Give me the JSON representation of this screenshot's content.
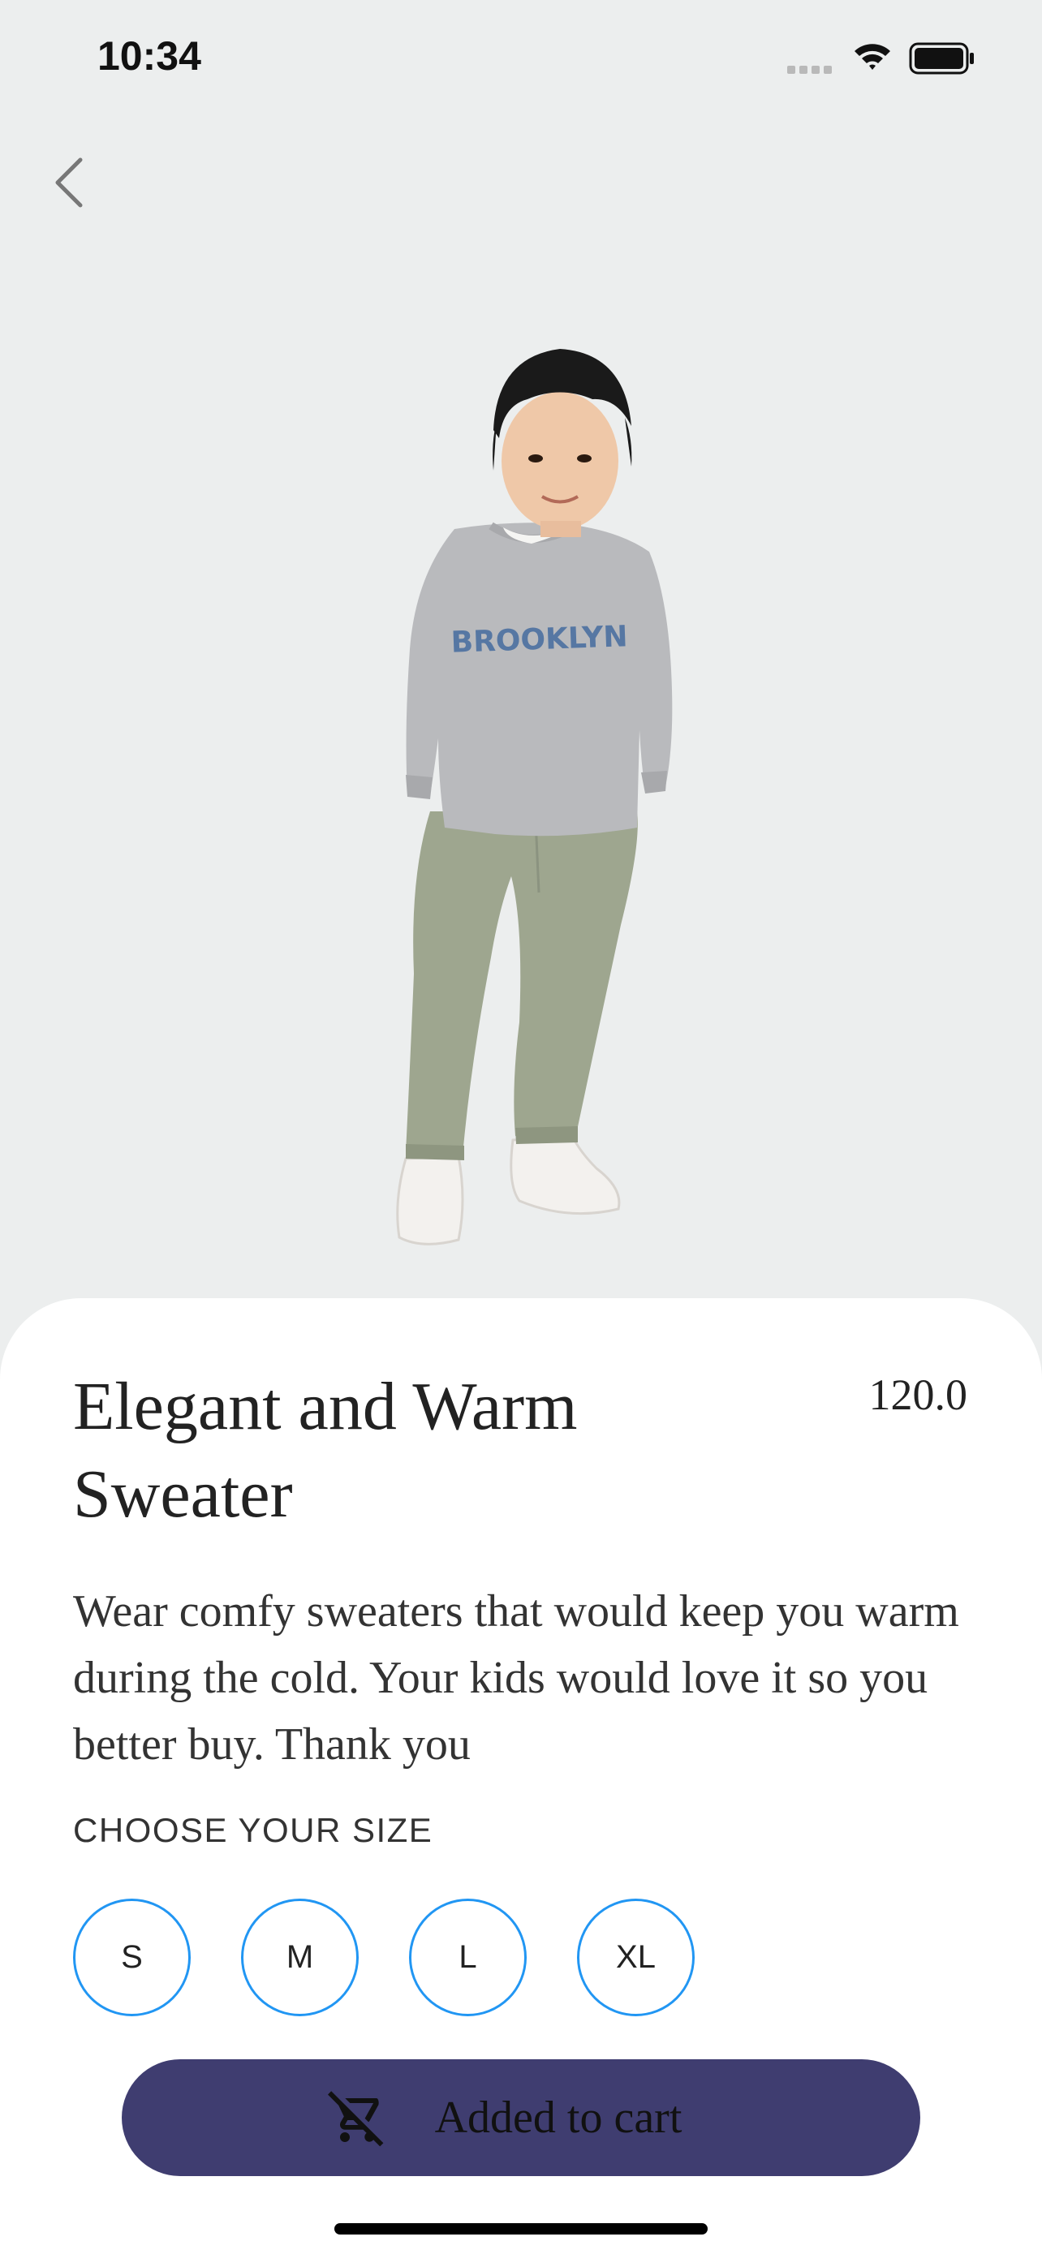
{
  "status_bar": {
    "time": "10:34"
  },
  "nav": {
    "back_icon": "chevron-left-icon"
  },
  "product": {
    "image_text": "BROOKLYN",
    "title": "Elegant and Warm Sweater",
    "price": "120.0",
    "description": "Wear comfy sweaters that would keep you warm during the cold. Your kids would love it so you better buy. Thank you"
  },
  "sizes": {
    "label": "CHOOSE YOUR SIZE",
    "options": [
      "S",
      "M",
      "L",
      "XL"
    ],
    "accent_color": "#2196f3"
  },
  "cart": {
    "label": "Added to cart",
    "icon": "remove-shopping-cart-icon",
    "background_color": "#3f3d70"
  }
}
